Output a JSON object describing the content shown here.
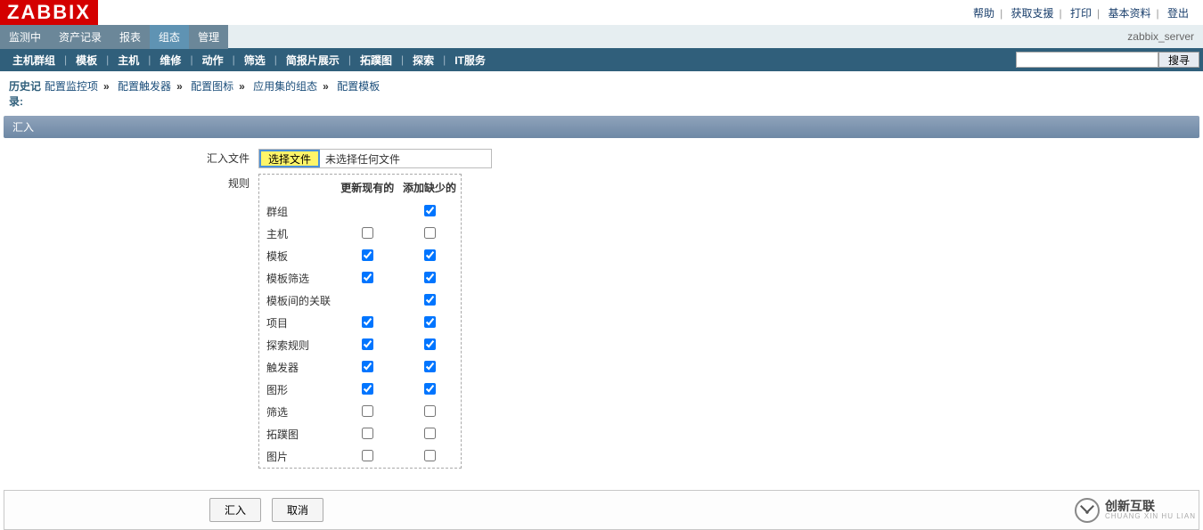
{
  "logo": "ZABBIX",
  "topLinks": [
    "帮助",
    "获取支援",
    "打印",
    "基本资料",
    "登出"
  ],
  "serverName": "zabbix_server",
  "mainTabs": [
    {
      "label": "监测中",
      "active": false
    },
    {
      "label": "资产记录",
      "active": false
    },
    {
      "label": "报表",
      "active": false
    },
    {
      "label": "组态",
      "active": true
    },
    {
      "label": "管理",
      "active": false
    }
  ],
  "subTabs": [
    "主机群组",
    "模板",
    "主机",
    "维修",
    "动作",
    "筛选",
    "简报片展示",
    "拓蹼图",
    "探索",
    "IT服务"
  ],
  "searchBtn": "搜寻",
  "historyLabel": "历史记录:",
  "breadcrumbs": [
    "配置监控项",
    "配置触发器",
    "配置图标",
    "应用集的组态",
    "配置模板"
  ],
  "sectionTitle": "汇入",
  "form": {
    "fileLabel": "汇入文件",
    "fileBtn": "选择文件",
    "fileNone": "未选择任何文件",
    "rulesLabel": "规则",
    "col1": "更新现有的",
    "col2": "添加缺少的",
    "rows": [
      {
        "label": "群组",
        "c1": null,
        "c2": true
      },
      {
        "label": "主机",
        "c1": false,
        "c2": false
      },
      {
        "label": "模板",
        "c1": true,
        "c2": true
      },
      {
        "label": "模板筛选",
        "c1": true,
        "c2": true
      },
      {
        "label": "模板间的关联",
        "c1": null,
        "c2": true
      },
      {
        "label": "项目",
        "c1": true,
        "c2": true
      },
      {
        "label": "探索规则",
        "c1": true,
        "c2": true
      },
      {
        "label": "触发器",
        "c1": true,
        "c2": true
      },
      {
        "label": "图形",
        "c1": true,
        "c2": true
      },
      {
        "label": "筛选",
        "c1": false,
        "c2": false
      },
      {
        "label": "拓蹼图",
        "c1": false,
        "c2": false
      },
      {
        "label": "图片",
        "c1": false,
        "c2": false
      }
    ]
  },
  "buttons": {
    "import": "汇入",
    "cancel": "取消"
  },
  "brand": {
    "cn": "创新互联",
    "en": "CHUANG XIN HU LIAN"
  }
}
